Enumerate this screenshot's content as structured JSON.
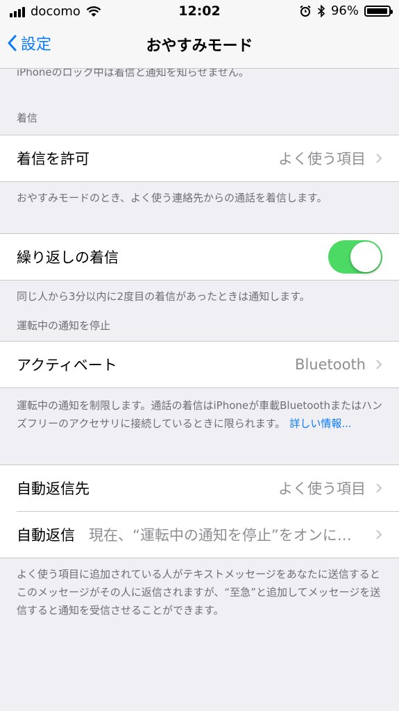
{
  "status_bar": {
    "carrier": "docomo",
    "time": "12:02",
    "battery": "96%",
    "battery_level": 0.96
  },
  "nav": {
    "back_label": "設定",
    "title": "おやすみモード"
  },
  "top_cut_text": "iPhoneのロック中は着信と通知を知らせません。",
  "calls": {
    "header": "着信",
    "allow_calls": {
      "label": "着信を許可",
      "value": "よく使う項目"
    },
    "allow_calls_footer": "おやすみモードのとき、よく使う連絡先からの通話を着信します。",
    "repeated_calls": {
      "label": "繰り返しの着信",
      "on": true
    },
    "repeated_calls_footer": "同じ人から3分以内に2度目の着信があったときは通知します。"
  },
  "driving": {
    "header": "運転中の通知を停止",
    "activate": {
      "label": "アクティベート",
      "value": "Bluetooth"
    },
    "footer": "運転中の通知を制限します。通話の着信はiPhoneが車載Bluetoothまたはハンズフリーのアクセサリに接続しているときに限られます。",
    "more_info_link": "詳しい情報..."
  },
  "auto_reply": {
    "to": {
      "label": "自動返信先",
      "value": "よく使う項目"
    },
    "reply": {
      "label": "自動返信",
      "value": "現在、“運転中の通知を停止”をオンにしているため、後ほど確認します。"
    },
    "footer": "よく使う項目に追加されている人がテキストメッセージをあなたに送信するとこのメッセージがその人に返信されますが、“至急”と追加してメッセージを送信すると通知を受信させることができます。"
  },
  "colors": {
    "accent": "#0a7aff",
    "toggle_on": "#4cd964",
    "background": "#efeff4"
  }
}
